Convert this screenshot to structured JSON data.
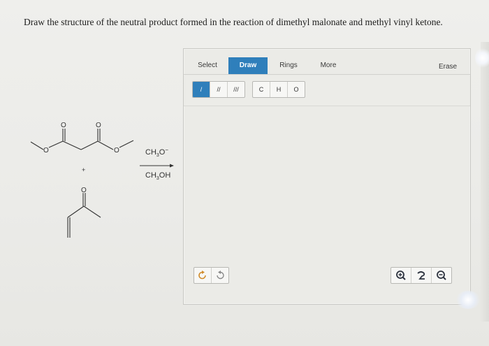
{
  "question": {
    "text": "Draw the structure of the neutral product formed in the reaction of dimethyl malonate and methyl vinyl ketone."
  },
  "reaction": {
    "plus": "+",
    "atom_o": "O",
    "reagent_above_main": "CH",
    "reagent_above_sub": "3",
    "reagent_above_end": "O",
    "reagent_above_sup": "−",
    "reagent_below_main": "CH",
    "reagent_below_sub": "3",
    "reagent_below_end": "OH"
  },
  "sketcher": {
    "tabs": [
      {
        "label": "Select"
      },
      {
        "label": "Draw"
      },
      {
        "label": "Rings"
      },
      {
        "label": "More"
      },
      {
        "label": "Erase"
      }
    ],
    "active_tab": "Draw",
    "bond_tools": [
      "/",
      "//",
      "///"
    ],
    "atom_tools": [
      "C",
      "H",
      "O"
    ],
    "undo_icons": [
      "undo-icon",
      "redo-icon"
    ],
    "zoom_icons": [
      "zoom-in-icon",
      "reset-icon",
      "zoom-out-icon"
    ],
    "accent_color": "#2f7fbb"
  }
}
